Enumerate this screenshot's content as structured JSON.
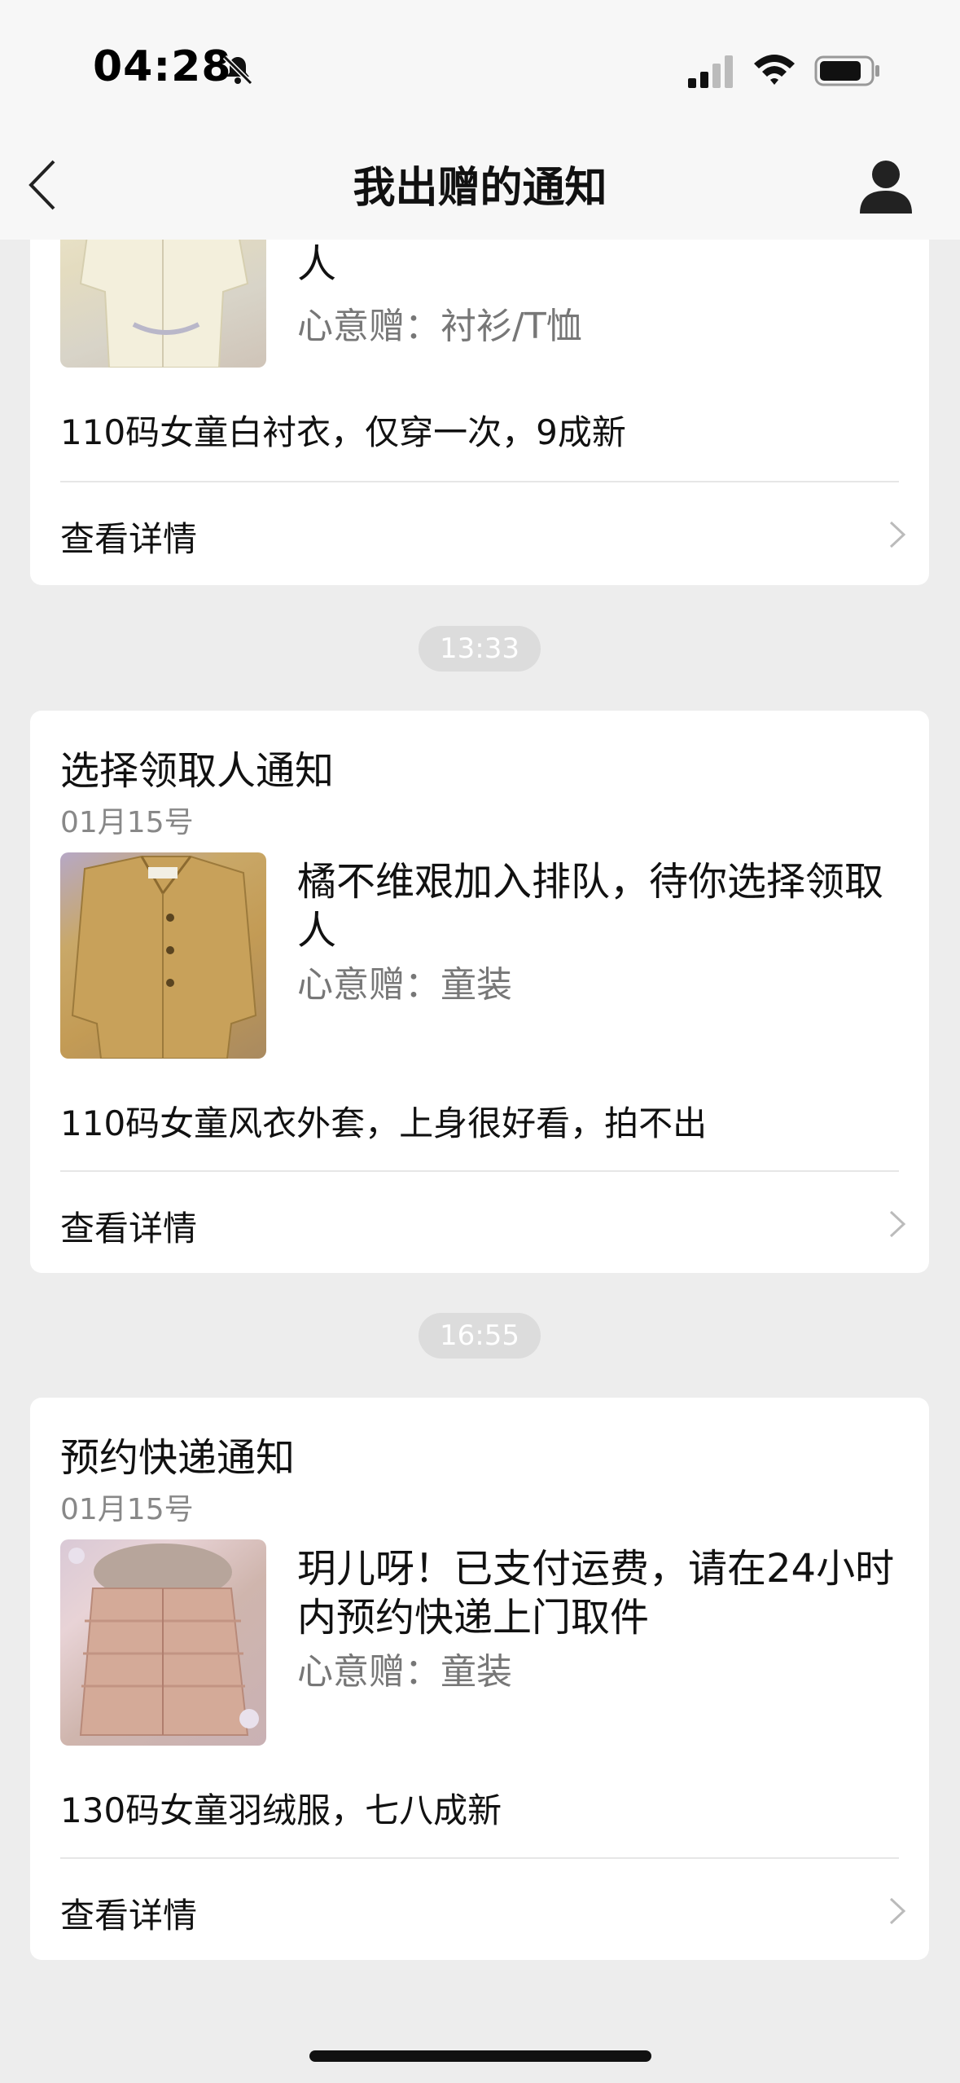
{
  "status": {
    "time": "04:28",
    "icons": [
      "bell-off-icon",
      "signal-icon",
      "wifi-icon",
      "battery-icon"
    ]
  },
  "nav": {
    "title": "我出赠的通知",
    "back_icon": "chevron-left-icon",
    "profile_icon": "person-icon"
  },
  "cards": [
    {
      "message_tail": "人",
      "gift": "心意赠：衬衫/T恤",
      "description": "110码女童白衬衣，仅穿一次，9成新",
      "detail": "查看详情"
    },
    {
      "time": "13:33",
      "title": "选择领取人通知",
      "date": "01月15号",
      "message": "橘不维艰加入排队，待你选择领取人",
      "gift": "心意赠：童装",
      "description": "110码女童风衣外套，上身很好看，拍不出",
      "detail": "查看详情"
    },
    {
      "time": "16:55",
      "title": "预约快递通知",
      "date": "01月15号",
      "message": "玥儿呀！已支付运费，请在24小时内预约快递上门取件",
      "gift": "心意赠：童装",
      "description": "130码女童羽绒服，七八成新",
      "detail": "查看详情"
    }
  ],
  "colors": {
    "background": "#ededed",
    "card": "#ffffff",
    "muted_text": "#888888",
    "time_pill": "#dcdcdc"
  }
}
